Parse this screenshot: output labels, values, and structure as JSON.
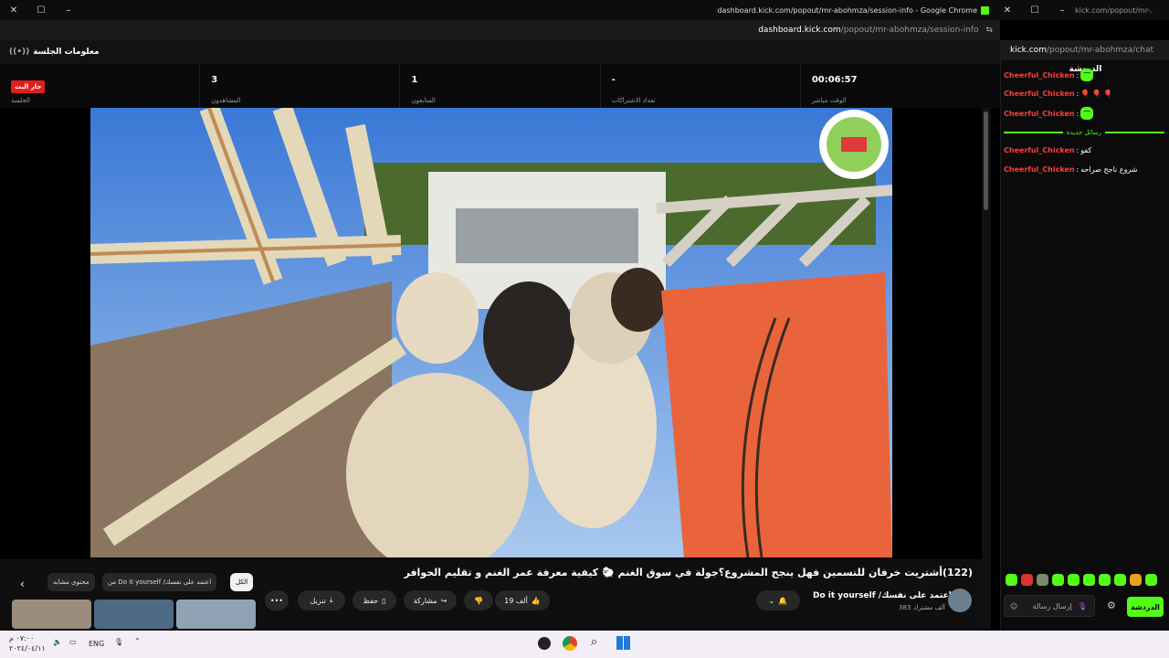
{
  "window_left": {
    "title": "dashboard.kick.com/popout/mr-abohmza/session-info - Google Chrome",
    "url_host": "dashboard.kick.com",
    "url_path": "/popout/mr-abohmza/session-info"
  },
  "window_right": {
    "title": "kick.com/popout/mr-...",
    "url_host": "kick.com",
    "url_path": "/popout/mr-abohmza/chat"
  },
  "session": {
    "header": "معلومات الجلسة",
    "live_badge": "جار البث",
    "session_label": "الجلسة",
    "viewers_value": "3",
    "viewers_label": "المشاهدون",
    "followers_value": "1",
    "followers_label": "المتابعون",
    "subs_value": "-",
    "subs_label": "تعداد الاشتراكات",
    "uptime_value": "00:06:57",
    "uptime_label": "الوقت مباشر"
  },
  "youtube": {
    "title": "(122)أشتريت خرفان للتسمين فهل ينجح المشروع؟جولة في سوق الغنم 🐑 كيفية معرفة عمر الغنم و تقليم الحوافر",
    "channel": "Do it yourself /اعتمد على نفسك",
    "subscribers": "383 ألف مشترك",
    "likes": "19 ألف",
    "share": "مشاركة",
    "save": "حفظ",
    "download": "تنزيل",
    "chip_all": "الكل",
    "chip_from": "من Do it yourself /اعتمد على نفسك",
    "chip_related": "محتوى مشابه"
  },
  "chat": {
    "header": "الدردشة",
    "messages": [
      {
        "user": "Cheerful_Chicken",
        "text": ""
      },
      {
        "user": "Cheerful_Chicken",
        "text": "🎈 🎈 🎈"
      },
      {
        "user": "Cheerful_Chicken",
        "text": ""
      },
      {
        "user": "Cheerful_Chicken",
        "text": "كفو"
      },
      {
        "user": "Cheerful_Chicken",
        "text": "شروع ناجح صراحه"
      }
    ],
    "new_messages": "رسائل جديدة",
    "input_placeholder": "إرسال رسالة",
    "send_label": "الدردشة"
  },
  "taskbar": {
    "time": "٠٧:٠٠ م",
    "date": "٢٠٢٤/٠٤/١١",
    "lang": "ENG"
  },
  "colors": {
    "kick_green": "#53fc18",
    "live_red": "#e01e1e",
    "chat_user": "#ff3d3d"
  }
}
